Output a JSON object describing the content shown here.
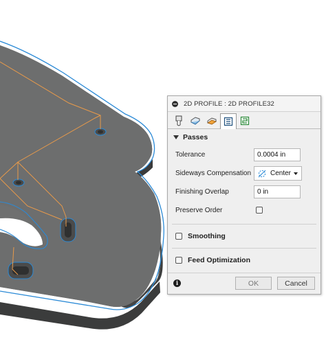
{
  "dialog": {
    "title": "2D PROFILE : 2D PROFILE32",
    "tabs": [
      {
        "icon": "tool-icon",
        "active": false
      },
      {
        "icon": "geometry-icon",
        "active": false
      },
      {
        "icon": "heights-icon",
        "active": false
      },
      {
        "icon": "passes-icon",
        "active": true
      },
      {
        "icon": "linking-icon",
        "active": false
      }
    ],
    "passes": {
      "section_label": "Passes",
      "tolerance_label": "Tolerance",
      "tolerance_value": "0.0004 in",
      "sideways_label": "Sideways Compensation",
      "sideways_value": "Center",
      "finishing_label": "Finishing Overlap",
      "finishing_value": "0 in",
      "preserve_label": "Preserve Order",
      "preserve_checked": false
    },
    "smoothing": {
      "label": "Smoothing",
      "checked": false
    },
    "feed_optimization": {
      "label": "Feed Optimization",
      "checked": false
    },
    "footer": {
      "ok_label": "OK",
      "cancel_label": "Cancel",
      "info_icon": "info-icon"
    }
  },
  "colors": {
    "part_top": "#6e6f6f",
    "part_side": "#3f4040",
    "edge_highlight": "#2b8ad6",
    "toolpath": "#e89a4a"
  }
}
